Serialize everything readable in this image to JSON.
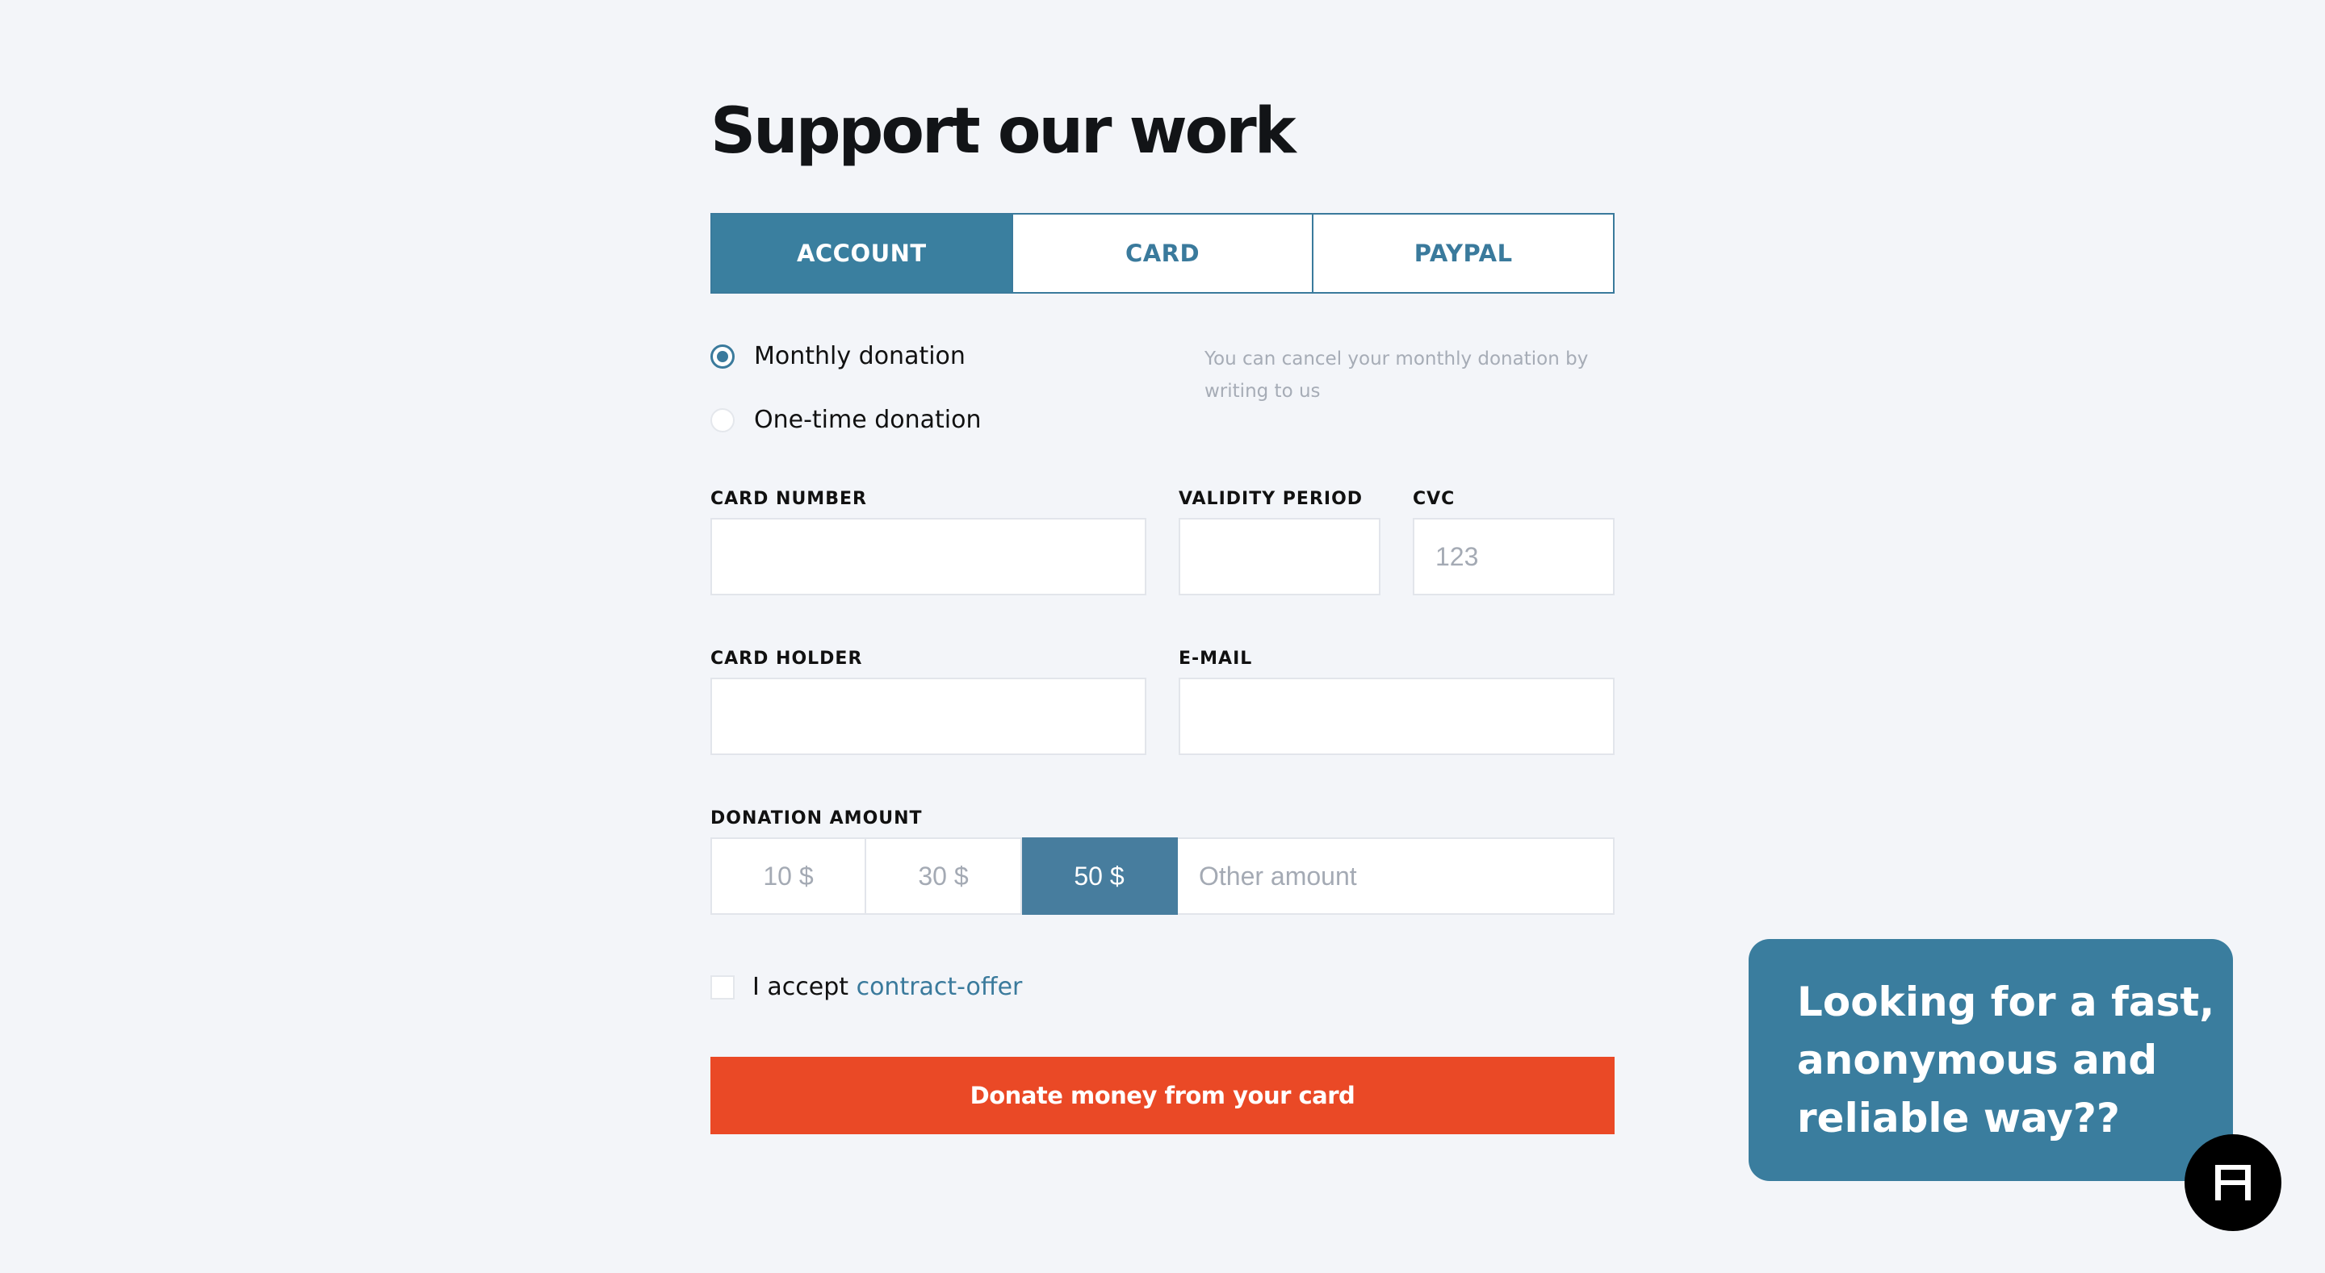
{
  "page": {
    "title": "Support our work"
  },
  "tabs": [
    {
      "label": "ACCOUNT",
      "active": true
    },
    {
      "label": "CARD",
      "active": false
    },
    {
      "label": "PAYPAL",
      "active": false
    }
  ],
  "donation_type": {
    "options": [
      {
        "label": "Monthly donation",
        "checked": true
      },
      {
        "label": "One-time donation",
        "checked": false
      }
    ],
    "note": "You can cancel your monthly donation by writing to us"
  },
  "fields": {
    "card_number": {
      "label": "CARD NUMBER",
      "value": "",
      "placeholder": ""
    },
    "validity_period": {
      "label": "VALIDITY PERIOD",
      "value": "",
      "placeholder": ""
    },
    "cvc": {
      "label": "CVC",
      "value": "",
      "placeholder": "123"
    },
    "card_holder": {
      "label": "CARD HOLDER",
      "value": "",
      "placeholder": ""
    },
    "email": {
      "label": "E-MAIL",
      "value": "",
      "placeholder": ""
    }
  },
  "amount": {
    "label": "DONATION AMOUNT",
    "options": [
      "10 $",
      "30 $",
      "50 $"
    ],
    "selected": "50 $",
    "other_placeholder": "Other amount"
  },
  "accept": {
    "text": "I accept",
    "link": "contract-offer",
    "checked": false
  },
  "donate_button": "Donate money from your card",
  "promo": {
    "lines": [
      "Looking for a fast,",
      "anonymous and",
      "reliable way??"
    ]
  },
  "colors": {
    "accent": "#3a7a9c",
    "button": "#ea4926",
    "background": "#f3f5f9"
  }
}
